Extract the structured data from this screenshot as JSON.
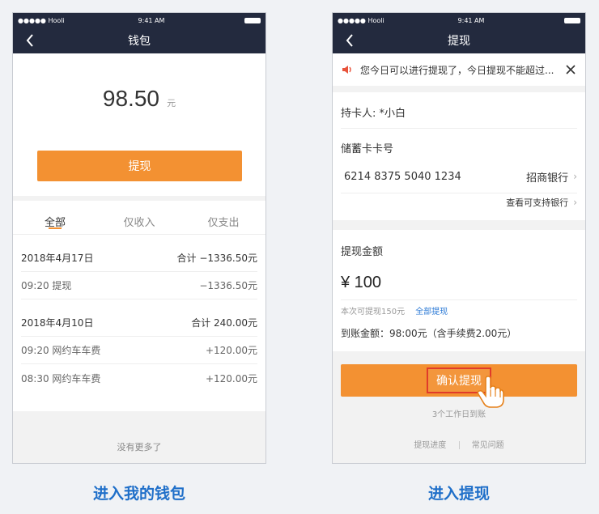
{
  "status_bar": {
    "carrier": "●●●●● Hooli",
    "time": "9:41 AM"
  },
  "wallet": {
    "title": "钱包",
    "balance": "98.50",
    "unit": "元",
    "withdraw_button": "提现",
    "tabs": [
      "全部",
      "仅收入",
      "仅支出"
    ],
    "groups": [
      {
        "date": "2018年4月17日",
        "total": "合计 −1336.50元",
        "items": [
          {
            "label": "09:20 提现",
            "amount": "−1336.50元"
          }
        ]
      },
      {
        "date": "2018年4月10日",
        "total": "合计 240.00元",
        "items": [
          {
            "label": "09:20 网约车车费",
            "amount": "+120.00元"
          },
          {
            "label": "08:30 网约车车费",
            "amount": "+120.00元"
          }
        ]
      }
    ],
    "no_more": "没有更多了"
  },
  "withdraw": {
    "title": "提现",
    "notice": "您今日可以进行提现了，今日提现不能超过...",
    "holder": "持卡人: *小白",
    "card_label": "储蓄卡卡号",
    "card_number": "6214 8375 5040 1234",
    "bank": "招商银行",
    "supported_banks": "查看可支持银行",
    "amount_label": "提现金额",
    "amount": "¥ 100",
    "available": "本次可提现150元",
    "withdraw_all": "全部提现",
    "arrival": "到账金额：98:00元（含手续费2.00元）",
    "confirm_button": "确认提现",
    "eta": "3个工作日到账",
    "progress_link": "提现进度",
    "faq_link": "常见问题"
  },
  "captions": {
    "left": "进入我的钱包",
    "right": "进入提现"
  },
  "colors": {
    "navbar": "#232a3e",
    "accent": "#f39132",
    "caption": "#1f6fc9",
    "highlight": "#e03b2a"
  }
}
